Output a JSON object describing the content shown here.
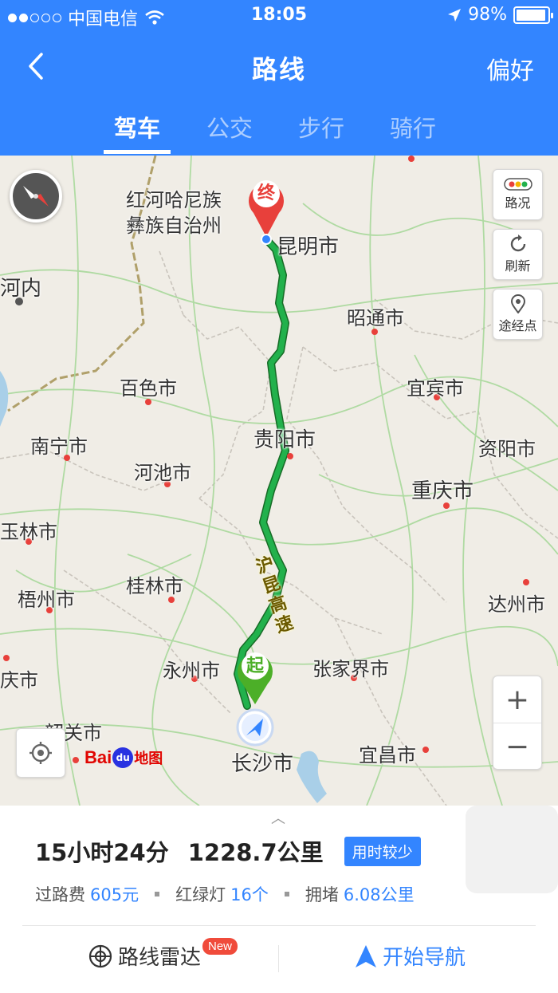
{
  "status_bar": {
    "carrier": "中国电信",
    "time": "18:05",
    "battery": "98%"
  },
  "nav": {
    "title": "路线",
    "preference": "偏好"
  },
  "tabs": [
    {
      "label": "驾车",
      "active": true
    },
    {
      "label": "公交",
      "active": false
    },
    {
      "label": "步行",
      "active": false
    },
    {
      "label": "骑行",
      "active": false
    }
  ],
  "map": {
    "cities": {
      "honghe": "红河哈尼族",
      "honghe2": "彝族自治州",
      "kunming": "昆明市",
      "hanoi": "河内",
      "zhaotong": "昭通市",
      "baise": "百色市",
      "yibin": "宜宾市",
      "nanning": "南宁市",
      "guiyang": "贵阳市",
      "ziyang": "资阳市",
      "hechi": "河池市",
      "chongqing": "重庆市",
      "yulin": "玉林市",
      "guilin": "桂林市",
      "wuzhou": "梧州市",
      "dazhou": "达州市",
      "yongzhou": "永州市",
      "zhangjiajie": "张家界市",
      "qingyuan": "庆市",
      "shaoguan": "韶关市",
      "yichang": "宜昌市",
      "changsha": "长沙市"
    },
    "highway_label": "沪昆高速",
    "end_marker": "终",
    "start_marker": "起",
    "controls": {
      "traffic": "路况",
      "refresh": "刷新",
      "waypoint": "途经点"
    },
    "logo": {
      "bai": "Bai",
      "du": "du",
      "ditu": "地图"
    }
  },
  "route_summary": {
    "duration": "15小时24分",
    "distance": "1228.7公里",
    "tag": "用时较少",
    "toll_label": "过路费",
    "toll_value": "605元",
    "lights_label": "红绿灯",
    "lights_value": "16个",
    "congestion_label": "拥堵",
    "congestion_value": "6.08公里"
  },
  "actions": {
    "radar": "路线雷达",
    "radar_badge": "New",
    "start_nav": "开始导航"
  },
  "colors": {
    "brand_blue": "#3385ff",
    "route_green": "#22b14c",
    "end_red": "#e8403b",
    "start_green": "#4caf28"
  }
}
